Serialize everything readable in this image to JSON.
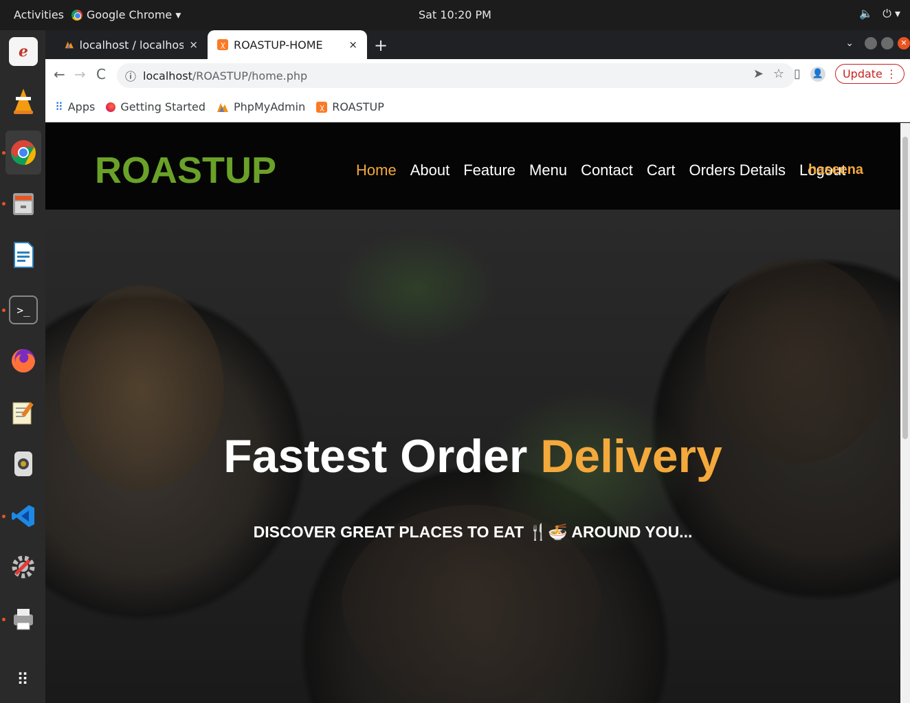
{
  "topbar": {
    "activities": "Activities",
    "app_name": "Google Chrome ▾",
    "clock": "Sat 10:20 PM",
    "volume_icon": "🔈",
    "power_icon": "⏻ ▾"
  },
  "dock": {
    "items": [
      "evince",
      "vlc",
      "chrome",
      "files",
      "writer",
      "terminal",
      "firefox",
      "text-editor",
      "webcam",
      "vscode",
      "settings",
      "printer",
      "show-apps"
    ]
  },
  "chrome": {
    "tabs": [
      {
        "title": "localhost / localhost / roa",
        "close": "×"
      },
      {
        "title": "ROASTUP-HOME",
        "close": "×"
      }
    ],
    "new_tab": "+",
    "url_host": "localhost",
    "url_path": "/ROASTUP/home.php",
    "info_icon": "ⓘ",
    "update_label": "Update",
    "bookmarks": [
      {
        "label": "Apps"
      },
      {
        "label": "Getting Started"
      },
      {
        "label": "PhpMyAdmin"
      },
      {
        "label": "ROASTUP"
      }
    ]
  },
  "site": {
    "logo": "ROASTUP",
    "nav": [
      "Home",
      "About",
      "Feature",
      "Menu",
      "Contact",
      "Cart",
      "Orders Details",
      "Logout"
    ],
    "username": "haseena",
    "hero_title_main": "Fastest Order ",
    "hero_title_accent": "Delivery",
    "hero_subtitle": "DISCOVER GREAT PLACES TO EAT 🍴🍜 AROUND YOU..."
  },
  "colors": {
    "logo_green": "#6aa128",
    "accent_orange": "#f4a93c",
    "header_bg": "#050505"
  }
}
